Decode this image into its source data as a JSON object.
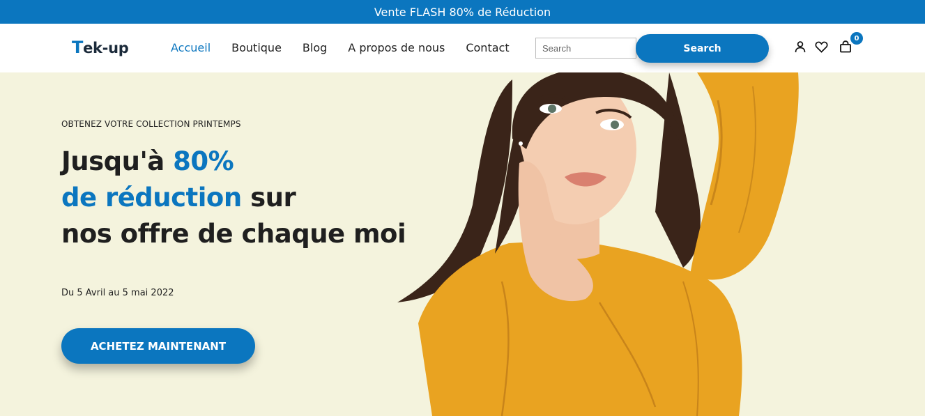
{
  "topbar": {
    "text": "Vente FLASH 80% de Réduction"
  },
  "header": {
    "logo": {
      "first": "T",
      "rest": "ek-up"
    },
    "nav": [
      {
        "label": "Accueil",
        "active": true
      },
      {
        "label": "Boutique"
      },
      {
        "label": "Blog"
      },
      {
        "label": "A propos de nous"
      },
      {
        "label": "Contact"
      }
    ],
    "search": {
      "placeholder": "Search",
      "value": "",
      "button_label": "Search"
    },
    "icons": {
      "user": "user-icon",
      "wishlist": "heart-icon",
      "cart": "shopping-bag-icon"
    },
    "cart_count": "0"
  },
  "hero": {
    "eyebrow": "OBTENEZ VOTRE COLLECTION PRINTEMPS",
    "headline": {
      "line1_prefix": "Jusqu'à ",
      "line1_highlight": "80%",
      "line2_highlight": "de réduction",
      "line2_suffix": " sur",
      "line3": "nos offre de chaque moi"
    },
    "dates": "Du 5 Avril au 5 mai 2022",
    "cta_label": "ACHETEZ MAINTENANT"
  },
  "colors": {
    "accent": "#0b76bf",
    "hero_bg": "#f4f3dd",
    "shirt": "#e9a321"
  }
}
